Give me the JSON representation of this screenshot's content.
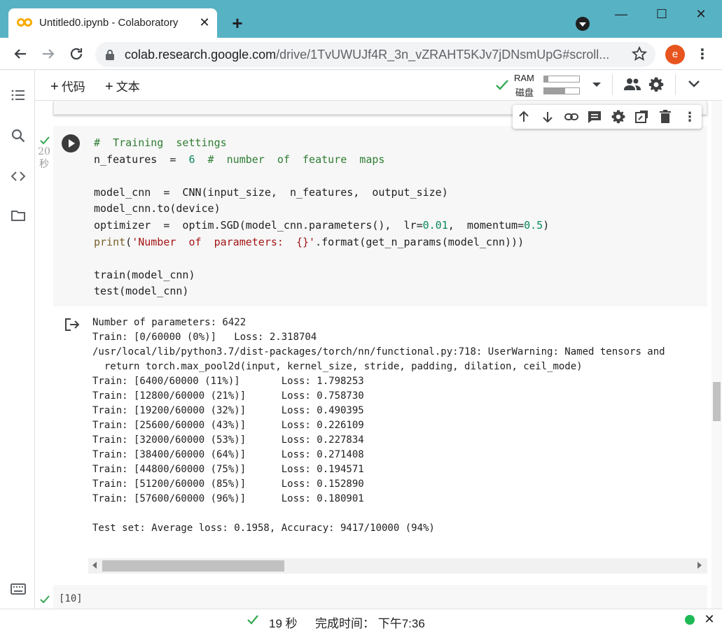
{
  "browser": {
    "tab_title": "Untitled0.ipynb - Colaboratory",
    "tab_close": "✕",
    "new_tab": "+",
    "window_minimize": "—",
    "window_maximize": "☐",
    "window_close": "✕",
    "url_host": "colab.research.google.com",
    "url_path": "/drive/1TvUWUJf4R_3n_vZRAHT5KJv7jDNsmUpG#scroll...",
    "avatar_letter": "e",
    "brand_color": "#57b2c4"
  },
  "header": {
    "add_code": "代码",
    "add_text": "文本",
    "ram_label": "RAM",
    "disk_label": "磁盘",
    "ram_usage": 0.12,
    "disk_usage": 0.6
  },
  "cell": {
    "exec_time_value": "20",
    "exec_time_unit": "秒",
    "code_lines": [
      [
        {
          "t": "#  Training  settings",
          "c": "comment"
        }
      ],
      [
        {
          "t": "n_features  =  "
        },
        {
          "t": "6",
          "c": "num"
        },
        {
          "t": "  #  number  of  feature  maps",
          "c": "comment"
        }
      ],
      [],
      [
        {
          "t": "model_cnn  =  CNN(input_size,  n_features,  output_size)"
        }
      ],
      [
        {
          "t": "model_cnn.to(device)"
        }
      ],
      [
        {
          "t": "optimizer  =  optim.SGD(model_cnn.parameters(),  lr="
        },
        {
          "t": "0.01",
          "c": "num"
        },
        {
          "t": ",  momentum="
        },
        {
          "t": "0.5",
          "c": "num"
        },
        {
          "t": ")"
        }
      ],
      [
        {
          "t": "print",
          "c": "fn"
        },
        {
          "t": "("
        },
        {
          "t": "'Number  of  parameters:  {}'",
          "c": "str"
        },
        {
          "t": ".format(get_n_params(model_cnn)))"
        }
      ],
      [],
      [
        {
          "t": "train(model_cnn)"
        }
      ],
      [
        {
          "t": "test(model_cnn)"
        }
      ]
    ],
    "output_lines": [
      "Number of parameters: 6422",
      "Train: [0/60000 (0%)]   Loss: 2.318704",
      "/usr/local/lib/python3.7/dist-packages/torch/nn/functional.py:718: UserWarning: Named tensors and",
      "  return torch.max_pool2d(input, kernel_size, stride, padding, dilation, ceil_mode)",
      "Train: [6400/60000 (11%)]       Loss: 1.798253",
      "Train: [12800/60000 (21%)]      Loss: 0.758730",
      "Train: [19200/60000 (32%)]      Loss: 0.490395",
      "Train: [25600/60000 (43%)]      Loss: 0.226109",
      "Train: [32000/60000 (53%)]      Loss: 0.227834",
      "Train: [38400/60000 (64%)]      Loss: 0.271408",
      "Train: [44800/60000 (75%)]      Loss: 0.194571",
      "Train: [51200/60000 (85%)]      Loss: 0.152890",
      "Train: [57600/60000 (96%)]      Loss: 0.180901",
      "",
      "Test set: Average loss: 0.1958, Accuracy: 9417/10000 (94%)"
    ]
  },
  "next_cell": {
    "exec_count": "[10]"
  },
  "statusbar": {
    "elapsed": "19 秒",
    "completed": "完成时间： 下午7:36"
  },
  "colors": {
    "check_green": "#34a853",
    "status_dot": "#1db954",
    "comment": "#2e7d32",
    "number": "#09885a",
    "string": "#a31515"
  }
}
